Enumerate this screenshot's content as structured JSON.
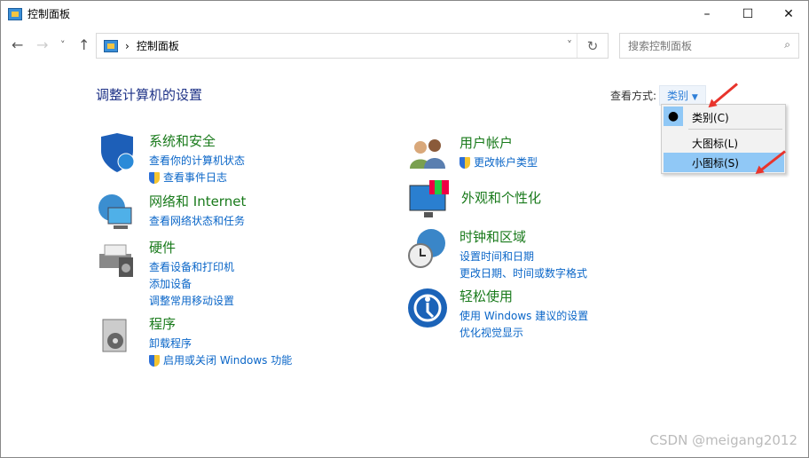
{
  "window": {
    "title": "控制面板",
    "minimize": "–",
    "maximize": "☐",
    "close": "✕"
  },
  "toolbar": {
    "back": "←",
    "forward": "→",
    "recent": "˅",
    "up": "↑",
    "breadcrumb": "控制面板",
    "separator": "›",
    "dropdown": "˅",
    "refresh": "↻",
    "search_placeholder": "搜索控制面板",
    "search_icon": "⌕"
  },
  "main": {
    "heading": "调整计算机的设置",
    "view_by_label": "查看方式:",
    "view_by_value": "类别",
    "view_menu": [
      {
        "label": "类别(C)",
        "checked": true
      },
      {
        "label": "大图标(L)"
      },
      {
        "label": "小图标(S)",
        "highlighted": true
      }
    ]
  },
  "categories": [
    {
      "title": "系统和安全",
      "links": [
        {
          "label": "查看你的计算机状态"
        },
        {
          "label": "查看事件日志",
          "shield": true
        }
      ]
    },
    {
      "title": "网络和 Internet",
      "links": [
        {
          "label": "查看网络状态和任务"
        }
      ]
    },
    {
      "title": "硬件",
      "links": [
        {
          "label": "查看设备和打印机"
        },
        {
          "label": "添加设备"
        },
        {
          "label": "调整常用移动设置"
        }
      ]
    },
    {
      "title": "程序",
      "links": [
        {
          "label": "卸载程序"
        },
        {
          "label": "启用或关闭 Windows 功能",
          "shield": true
        }
      ]
    },
    {
      "title": "用户帐户",
      "links": [
        {
          "label": "更改帐户类型",
          "shield": true
        }
      ]
    },
    {
      "title": "外观和个性化",
      "links": []
    },
    {
      "title": "时钟和区域",
      "links": [
        {
          "label": "设置时间和日期"
        },
        {
          "label": "更改日期、时间或数字格式"
        }
      ]
    },
    {
      "title": "轻松使用",
      "links": [
        {
          "label": "使用 Windows 建议的设置"
        },
        {
          "label": "优化视觉显示"
        }
      ]
    }
  ],
  "watermark": "CSDN @meigang2012",
  "colors": {
    "link": "#0a66c8",
    "category": "#197a1b",
    "heading": "#1e3287",
    "menu_highlight": "#90c8f6"
  }
}
